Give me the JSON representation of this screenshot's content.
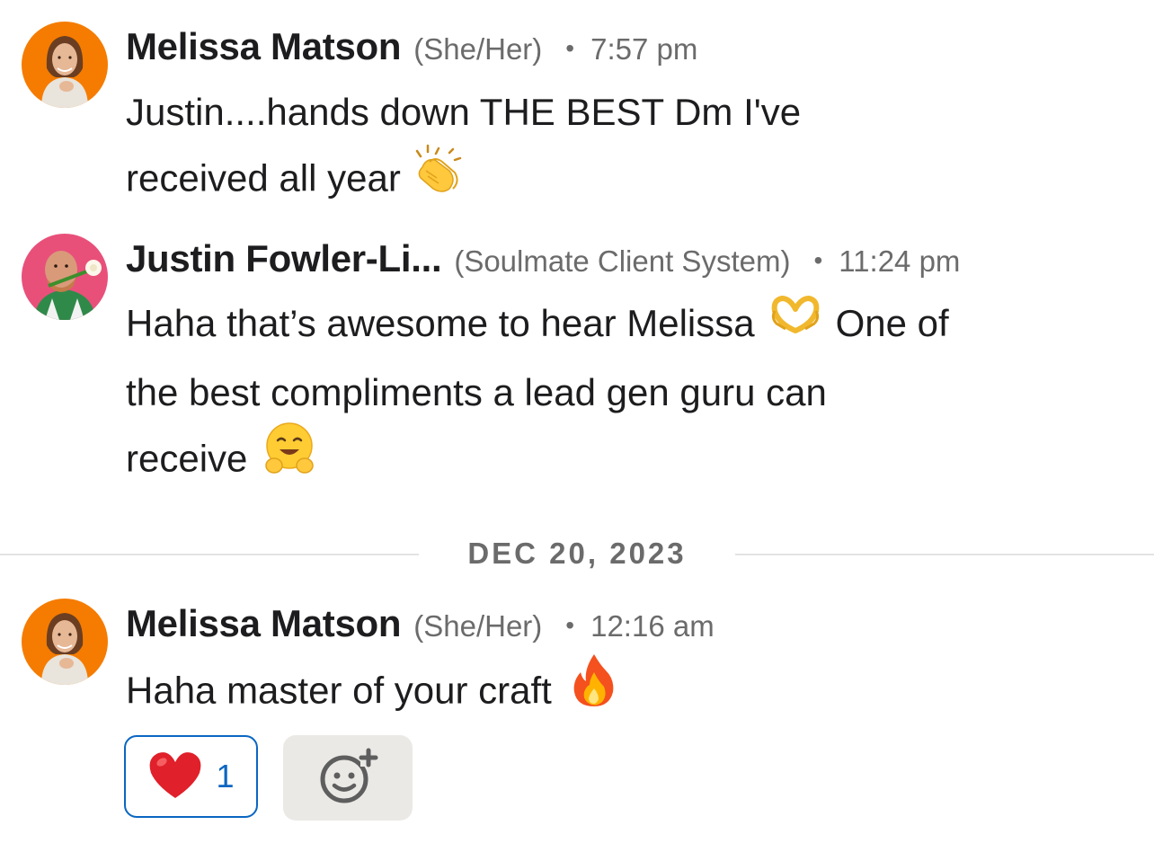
{
  "messages": [
    {
      "sender": "Melissa Matson",
      "pronoun": "(She/Her)",
      "time": "7:57 pm",
      "lines": [
        "Justin....hands down THE BEST Dm I've",
        "received all year"
      ],
      "emoji": "clapping-hands"
    },
    {
      "sender": "Justin Fowler-Li...",
      "pronoun": "(Soulmate Client System)",
      "time": "11:24 pm",
      "lines": [
        "Haha that’s awesome to hear Melissa",
        "One of",
        "the best compliments a lead gen guru can",
        "receive"
      ],
      "emoji": "heart-hands, hugging-face"
    },
    {
      "sender": "Melissa Matson",
      "pronoun": "(She/Her)",
      "time": "12:16 am",
      "lines": [
        "Haha master of your craft"
      ],
      "emoji": "fire"
    }
  ],
  "date_divider": "DEC 20, 2023",
  "reactions": [
    {
      "icon": "red-heart",
      "count": "1"
    }
  ],
  "add_reaction_icon": "add-emoji-icon",
  "colors": {
    "accent": "#0a66c2",
    "avatar_melissa_bg": "#f57c00",
    "avatar_justin_bg": "#e8507a",
    "meta_text": "#6b6b6b",
    "add_reaction_bg": "#ebe9e5"
  }
}
